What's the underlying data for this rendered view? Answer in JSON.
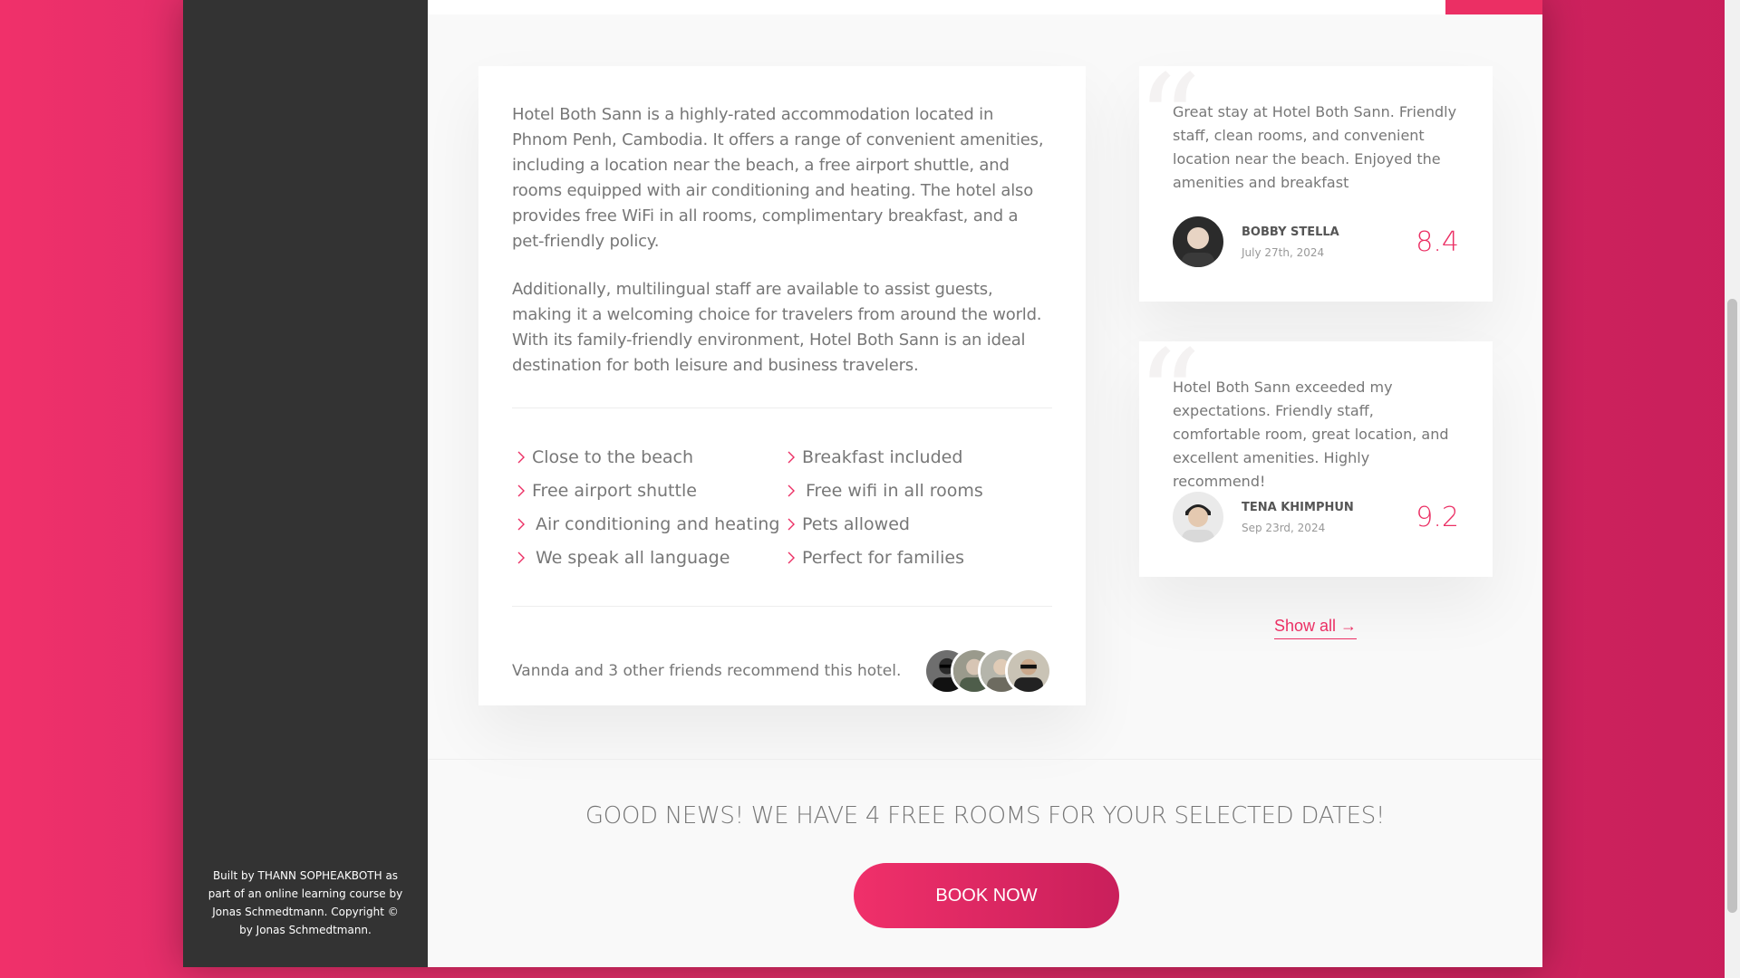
{
  "sidebar": {
    "copyright": "Built by THANN SOPHEAKBOTH as part of an online learning course by Jonas Schmedtmann. Copyright © by Jonas Schmedtmann."
  },
  "description": {
    "paragraph_1": "Hotel Both Sann is a highly-rated accommodation located in Phnom Penh, Cambodia. It offers a range of convenient amenities, including a location near the beach, a free airport shuttle, and rooms equipped with air conditioning and heating. The hotel also provides free WiFi in all rooms, complimentary breakfast, and a pet-friendly policy.",
    "paragraph_2": "Additionally, multilingual staff are available to assist guests, making it a welcoming choice for travelers from around the world. With its family-friendly environment, Hotel Both Sann is an ideal destination for both leisure and business travelers.",
    "features": [
      "Close to the beach",
      "Breakfast included",
      "Free airport shuttle",
      "Free wifi in all rooms",
      "Air conditioning and heating",
      "Pets allowed",
      "We speak all language",
      "Perfect for families"
    ],
    "recommend_text": "Vannda and 3 other friends recommend this hotel."
  },
  "reviews": [
    {
      "text": "Great stay at Hotel Both Sann. Friendly staff, clean rooms, and convenient location near the beach. Enjoyed the amenities and breakfast",
      "name": "Bobby Stella",
      "date": "July 27th, 2024",
      "rating": "8.4"
    },
    {
      "text": "Hotel Both Sann exceeded my expectations. Friendly staff, comfortable room, great location, and excellent amenities. Highly recommend!",
      "name": "Tena Khimphun",
      "date": "Sep 23rd, 2024",
      "rating": "9.2"
    }
  ],
  "show_all": "Show all →",
  "cta": {
    "title": "Good news! We have 4 free rooms for your selected dates!",
    "button": "Book now"
  },
  "colors": {
    "accent": "#eb2f64",
    "sidebar": "#333333"
  },
  "icons": {
    "feature_bullet": "chevron-right-icon",
    "quote": "quote-icon"
  }
}
